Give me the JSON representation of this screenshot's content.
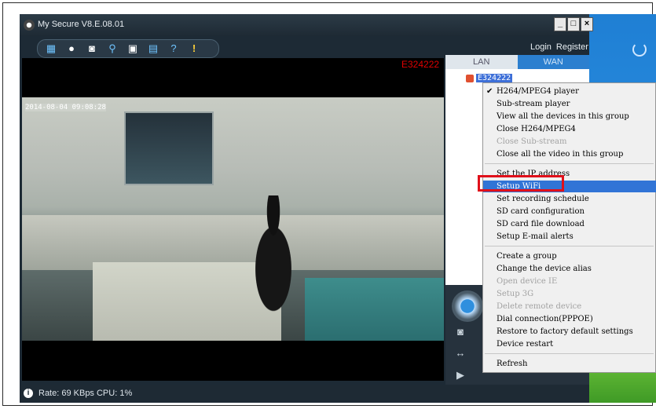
{
  "window": {
    "title": "My Secure  V8.E.08.01",
    "controls": [
      "_",
      "□",
      "×"
    ]
  },
  "header": {
    "login_label": "Login",
    "register_label": "Register"
  },
  "toolbar": {
    "icons": [
      "grid-icon",
      "play-icon",
      "camera-icon",
      "search-icon",
      "lock-icon",
      "save-icon",
      "help-icon",
      "alert-icon"
    ]
  },
  "video": {
    "timestamp": "2014-08-04 09:08:28",
    "device_id": "E324222"
  },
  "sidebar": {
    "tabs": [
      {
        "label": "LAN"
      },
      {
        "label": "WAN"
      }
    ],
    "device_node": "E324222"
  },
  "context_menu": {
    "items": [
      {
        "label": "H264/MPEG4 player",
        "checked": true
      },
      {
        "label": "Sub-stream player"
      },
      {
        "label": "View all the devices in this group"
      },
      {
        "label": "Close H264/MPEG4"
      },
      {
        "label": "Close Sub-stream",
        "disabled": true
      },
      {
        "label": "Close all the video in this group"
      },
      {
        "label": "Set the IP address"
      },
      {
        "label": "Setup WiFi",
        "active": true
      },
      {
        "label": "Set recording schedule"
      },
      {
        "label": "SD card configuration"
      },
      {
        "label": "SD card file download"
      },
      {
        "label": "Setup E-mail alerts"
      },
      {
        "label": "Create a group"
      },
      {
        "label": "Change the device alias"
      },
      {
        "label": "Open device IE",
        "disabled": true
      },
      {
        "label": "Setup 3G",
        "disabled": true
      },
      {
        "label": "Delete remote device",
        "disabled": true
      },
      {
        "label": "Dial connection(PPPOE)"
      },
      {
        "label": "Restore to factory default settings"
      },
      {
        "label": "Device restart"
      },
      {
        "label": "Refresh"
      }
    ]
  },
  "status": {
    "text": "Rate: 69 KBps  CPU:  1%"
  },
  "colors": {
    "menu_highlight": "#3174d6",
    "annotation_box": "#e0101a",
    "device_id_red": "#e00000"
  }
}
